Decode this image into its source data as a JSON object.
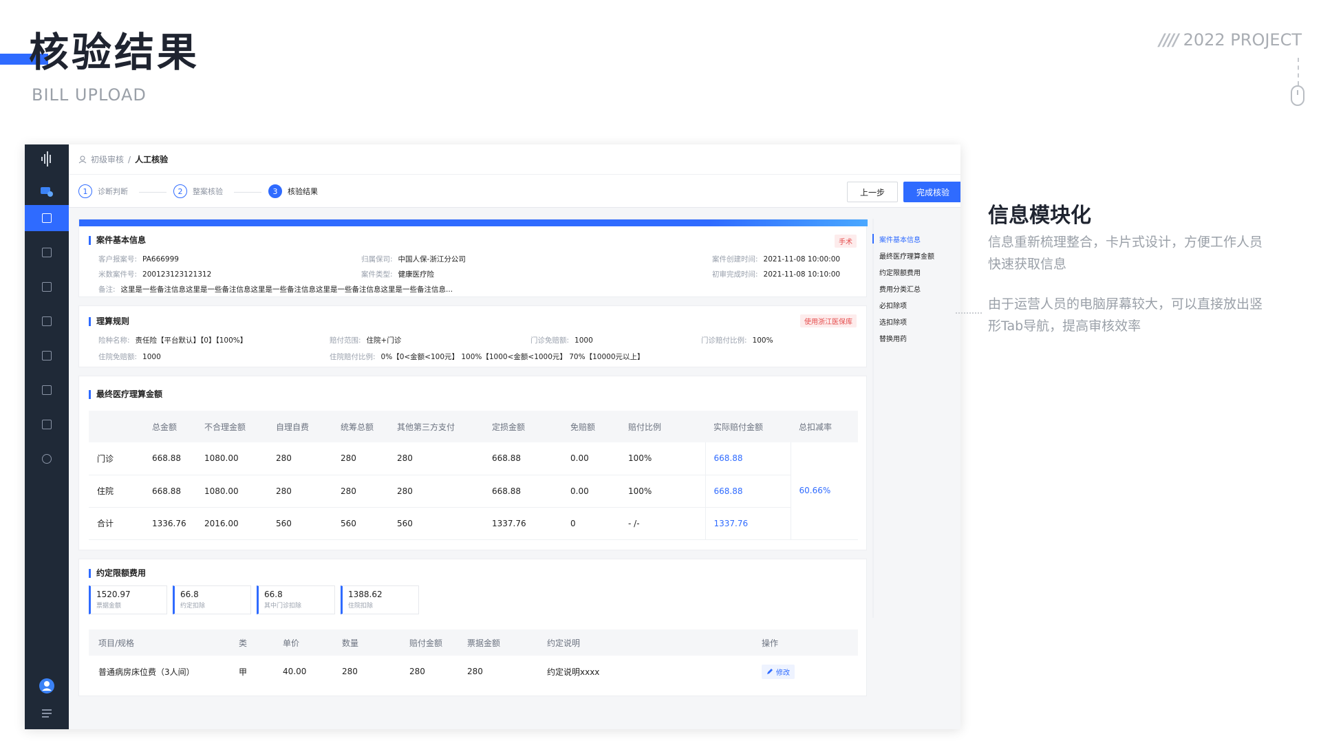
{
  "header": {
    "title_zh": "核验结果",
    "title_en": "BILL UPLOAD",
    "project": "2022 PROJECT",
    "project_slashes": "////"
  },
  "breadcrumb": {
    "parent": "初级审核",
    "separator": "/",
    "current": "人工核验"
  },
  "steps": [
    {
      "num": "1",
      "label": "诊断判断"
    },
    {
      "num": "2",
      "label": "整案核验"
    },
    {
      "num": "3",
      "label": "核验结果"
    }
  ],
  "buttons": {
    "prev": "上一步",
    "done": "完成核验"
  },
  "case_info": {
    "title": "案件基本信息",
    "tag": "手术",
    "fields": [
      {
        "k": "客户报案号:",
        "v": "PA666999"
      },
      {
        "k": "归属保司:",
        "v": "中国人保-浙江分公司"
      },
      {
        "k": "案件创建时间:",
        "v": "2021-11-08  10:00:00"
      },
      {
        "k": "米数案件号:",
        "v": "200123123121312"
      },
      {
        "k": "案件类型:",
        "v": "健康医疗险"
      },
      {
        "k": "初审完成时间:",
        "v": "2021-11-08  10:10:00"
      }
    ],
    "note_k": "备注:",
    "note_v": "这里是一些备注信息这里是一些备注信息这里是一些备注信息这里是一些备注信息这里是一些备注信息..."
  },
  "rules": {
    "title": "理算规则",
    "tag": "使用浙江医保库",
    "fields": [
      {
        "k": "险种名称:",
        "v": "责任险【平台默认】【0】【100%】"
      },
      {
        "k": "赔付范围:",
        "v": "住院+门诊"
      },
      {
        "k": "门诊免赔额:",
        "v": "1000"
      },
      {
        "k": "门诊赔付比例:",
        "v": "100%"
      },
      {
        "k": "住院免赔额:",
        "v": "1000"
      },
      {
        "k": "住院赔付比例:",
        "v": "0%【0<金额<100元】  100%【1000<金额<1000元】  70%【10000元以上】"
      }
    ]
  },
  "final": {
    "title": "最终医疗理算金额",
    "headers": [
      "",
      "总金额",
      "不合理金额",
      "自理自费",
      "统筹总额",
      "其他第三方支付",
      "定损金额",
      "免赔额",
      "赔付比例",
      "实际赔付金额",
      "总扣减率"
    ],
    "rows": [
      [
        "门诊",
        "668.88",
        "1080.00",
        "280",
        "280",
        "280",
        "668.88",
        "0.00",
        "100%",
        "668.88"
      ],
      [
        "住院",
        "668.88",
        "1080.00",
        "280",
        "280",
        "280",
        "668.88",
        "0.00",
        "100%",
        "668.88"
      ],
      [
        "合计",
        "1336.76",
        "2016.00",
        "560",
        "560",
        "560",
        "1337.76",
        "0",
        "- /-",
        "1337.76"
      ]
    ],
    "deduction_rate": "60.66%"
  },
  "agreed": {
    "title": "约定限额费用",
    "minis": [
      {
        "v": "1520.97",
        "l": "票据金额"
      },
      {
        "v": "66.8",
        "l": "约定扣除"
      },
      {
        "v": "66.8",
        "l": "其中门诊扣除"
      },
      {
        "v": "1388.62",
        "l": "住院扣除"
      }
    ],
    "headers": [
      "项目/规格",
      "类",
      "单价",
      "数量",
      "赔付金额",
      "票据金额",
      "约定说明",
      "操作"
    ],
    "row": [
      "普通病房床位费（3人间）",
      "甲",
      "40.00",
      "280",
      "280",
      "280",
      "约定说明xxxx"
    ],
    "edit_label": "修改"
  },
  "tabnav": [
    "案件基本信息",
    "最终医疗理算金额",
    "约定限额费用",
    "费用分类汇总",
    "必扣除项",
    "选扣除项",
    "替换用药"
  ],
  "feature": {
    "title": "信息模块化",
    "p1": "信息重新梳理整合，卡片式设计，方便工作人员快速获取信息",
    "p2": "由于运营人员的电脑屏幕较大，可以直接放出竖形Tab导航，提高审核效率"
  },
  "colors": {
    "accent": "#2f6bff",
    "sidebar": "#1f2937",
    "danger": "#e54c4c"
  }
}
